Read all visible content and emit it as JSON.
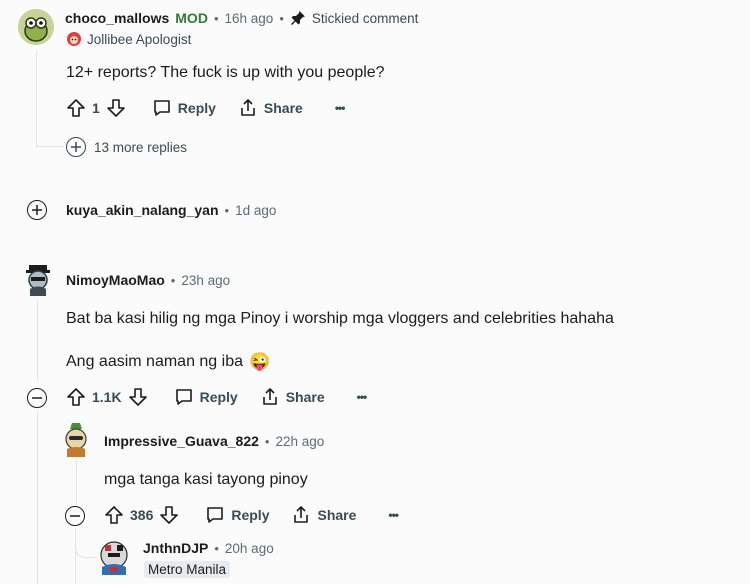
{
  "comments": [
    {
      "username": "choco_mallows",
      "mod_badge": "MOD",
      "time": "16h ago",
      "sticky_label": "Stickied comment",
      "flair": "Jollibee Apologist",
      "body": "12+ reports? The fuck is up with you people?",
      "score": "1",
      "reply_label": "Reply",
      "share_label": "Share",
      "more_label": "•••",
      "more_replies": "13 more replies"
    },
    {
      "username": "kuya_akin_nalang_yan",
      "time": "1d ago"
    },
    {
      "username": "NimoyMaoMao",
      "time": "23h ago",
      "body_line1": "Bat ba kasi hilig ng mga Pinoy i worship mga vloggers and celebrities hahaha",
      "body_line2": "Ang aasim naman ng iba",
      "emoji": "😜",
      "score": "1.1K",
      "reply_label": "Reply",
      "share_label": "Share",
      "more_label": "•••"
    },
    {
      "username": "Impressive_Guava_822",
      "time": "22h ago",
      "body": "mga tanga kasi tayong pinoy",
      "score": "386",
      "reply_label": "Reply",
      "share_label": "Share",
      "more_label": "•••"
    },
    {
      "username": "JnthnDJP",
      "time": "20h ago",
      "flair": "Metro Manila"
    }
  ],
  "separator": "•",
  "colors": {
    "mod_green": "#2f7d32",
    "meta_grey": "#5c6c74",
    "line": "#e0e4e6"
  },
  "icons": [
    "upvote-icon",
    "downvote-icon",
    "comment-icon",
    "share-icon",
    "pin-icon",
    "expand-icon",
    "collapse-icon"
  ]
}
